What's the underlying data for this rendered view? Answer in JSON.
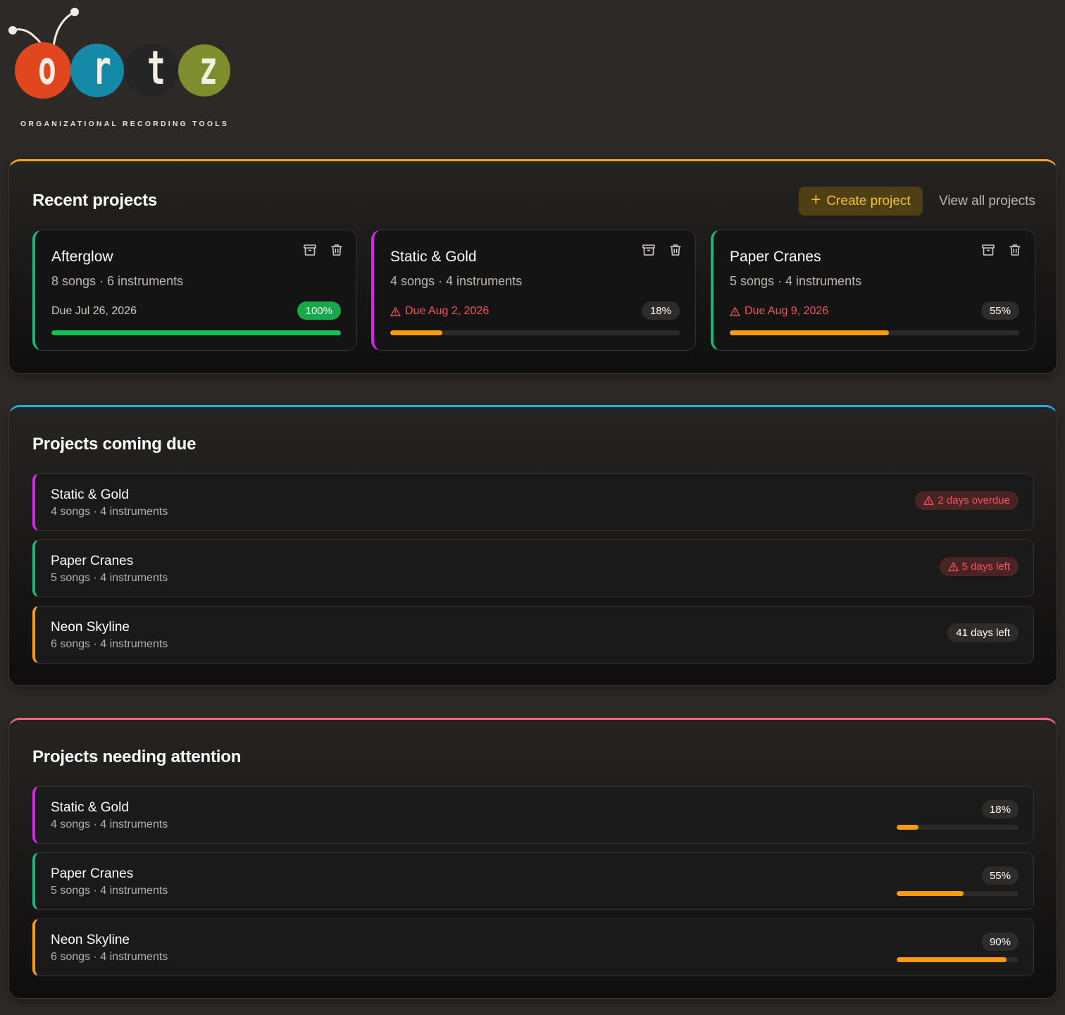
{
  "logo": {
    "letters": [
      "o",
      "r",
      "t",
      "z"
    ],
    "tagline": "ORGANIZATIONAL RECORDING TOOLS",
    "colors": [
      "#e2461f",
      "#1589a8",
      "#252525",
      "#7f8e2c"
    ]
  },
  "recent": {
    "title": "Recent projects",
    "accent": "#f5a623",
    "create_label": "Create project",
    "view_all_label": "View all projects",
    "cards": [
      {
        "name": "Afterglow",
        "meta": "8 songs · 6 instruments",
        "due": "Due Jul 26, 2026",
        "overdue_warning": false,
        "progress_label": "100%",
        "progress": 100,
        "color": "#1db575"
      },
      {
        "name": "Static & Gold",
        "meta": "4 songs · 4 instruments",
        "due": "Due Aug 2, 2026",
        "overdue_warning": true,
        "progress_label": "18%",
        "progress": 18,
        "color": "#d428e6"
      },
      {
        "name": "Paper Cranes",
        "meta": "5 songs · 4 instruments",
        "due": "Due Aug 9, 2026",
        "overdue_warning": true,
        "progress_label": "55%",
        "progress": 55,
        "color": "#1db575"
      }
    ]
  },
  "coming_due": {
    "title": "Projects coming due",
    "accent": "#19b2ec",
    "rows": [
      {
        "name": "Static & Gold",
        "meta": "4 songs · 4 instruments",
        "status": "2 days overdue",
        "warning": true,
        "color": "#d428e6"
      },
      {
        "name": "Paper Cranes",
        "meta": "5 songs · 4 instruments",
        "status": "5 days left",
        "warning": true,
        "color": "#1db575"
      },
      {
        "name": "Neon Skyline",
        "meta": "6 songs · 4 instruments",
        "status": "41 days left",
        "warning": false,
        "color": "#fd9a0e"
      }
    ]
  },
  "attention": {
    "title": "Projects needing attention",
    "accent": "#f06b80",
    "rows": [
      {
        "name": "Static & Gold",
        "meta": "4 songs · 4 instruments",
        "progress_label": "18%",
        "progress": 18,
        "color": "#d428e6"
      },
      {
        "name": "Paper Cranes",
        "meta": "5 songs · 4 instruments",
        "progress_label": "55%",
        "progress": 55,
        "color": "#1db575"
      },
      {
        "name": "Neon Skyline",
        "meta": "6 songs · 4 instruments",
        "progress_label": "90%",
        "progress": 90,
        "color": "#fd9a0e"
      }
    ]
  }
}
